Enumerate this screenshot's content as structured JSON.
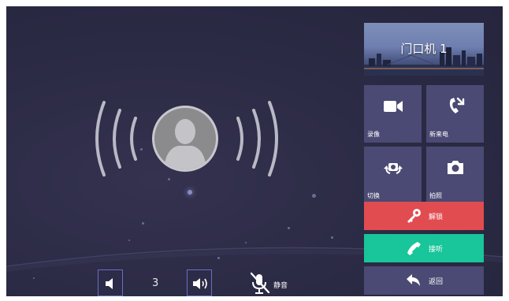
{
  "camera": {
    "name": "门口机 1"
  },
  "actions": {
    "record": {
      "label": "录像",
      "icon": "video-camera-icon"
    },
    "new_call": {
      "label": "新来电",
      "icon": "incoming-call-icon"
    },
    "switch": {
      "label": "切换",
      "icon": "camera-switch-icon"
    },
    "snapshot": {
      "label": "拍照",
      "icon": "camera-icon"
    },
    "unlock": {
      "label": "解锁",
      "icon": "key-icon",
      "color": "#e14c50"
    },
    "answer": {
      "label": "接听",
      "icon": "phone-icon",
      "color": "#19c59a"
    },
    "back": {
      "label": "返回",
      "icon": "back-arrow-icon"
    }
  },
  "volume": {
    "level": "3",
    "down_icon": "volume-down-icon",
    "up_icon": "volume-up-icon"
  },
  "mute": {
    "label": "静音",
    "icon": "microphone-muted-icon"
  },
  "caller": {
    "avatar_icon": "person-avatar-icon"
  }
}
